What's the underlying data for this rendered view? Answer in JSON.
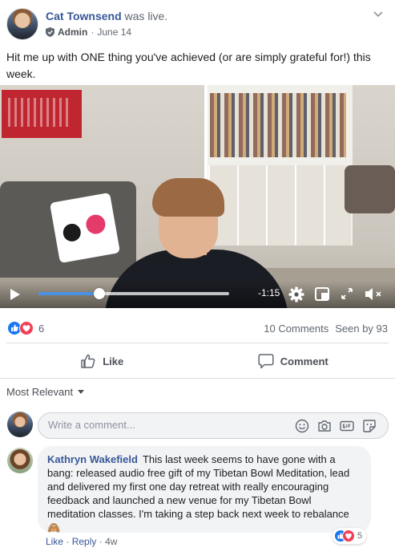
{
  "post": {
    "author": "Cat Townsend",
    "action": "was live.",
    "role": "Admin",
    "separator": "·",
    "date": "June 14",
    "text": "Hit me up with ONE thing you've achieved (or are simply grateful for!) this week."
  },
  "video": {
    "time_remaining": "-1:15",
    "progress_fraction": 0.32
  },
  "stats": {
    "reaction_count": "6",
    "reaction_types": [
      "like",
      "love"
    ],
    "comments": "10 Comments",
    "seen_by": "Seen by 93"
  },
  "actions": {
    "like": "Like",
    "comment": "Comment"
  },
  "comments_section": {
    "sort_label": "Most Relevant",
    "composer_placeholder": "Write a comment...",
    "composer_icons": [
      "emoji-icon",
      "camera-icon",
      "gif-icon",
      "sticker-icon"
    ]
  },
  "comment": {
    "author": "Kathryn Wakefield",
    "text": "This last week seems to have gone with a bang: released audio free gift of my Tibetan Bowl Meditation, lead and delivered my first one day retreat with really encouraging feedback and launched a new venue for my Tibetan Bowl meditation classes. I'm taking a step back next week to rebalance 🙈",
    "reaction_count": "5",
    "like_label": "Like",
    "reply_label": "Reply",
    "separator": "·",
    "age": "4w"
  },
  "colors": {
    "link": "#385898",
    "like_blue": "#1877f2",
    "love_red": "#f33e58",
    "progress": "#4a90e2"
  }
}
